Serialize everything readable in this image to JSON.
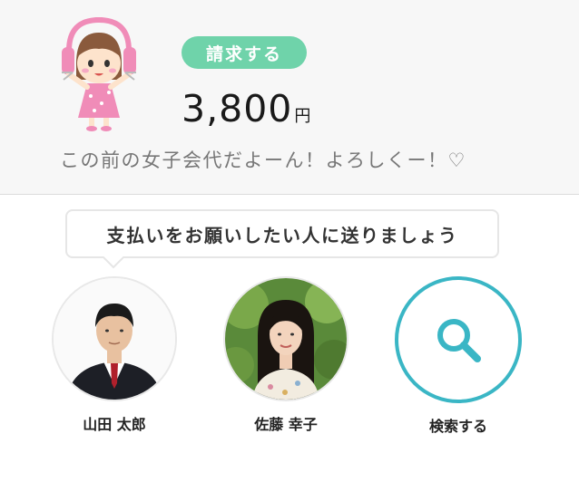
{
  "request": {
    "badge_label": "請求する",
    "amount": "3,800",
    "currency": "円",
    "message": "この前の女子会代だよーん！よろしくー！♡"
  },
  "prompt": {
    "text": "支払いをお願いしたい人に送りましょう"
  },
  "contacts": [
    {
      "name": "山田 太郎",
      "icon": "avatar-man-suit"
    },
    {
      "name": "佐藤 幸子",
      "icon": "avatar-woman-outdoor"
    }
  ],
  "search": {
    "label": "検索する",
    "icon": "search-icon"
  },
  "colors": {
    "badge": "#6fd3aa",
    "search_accent": "#3ab6c5",
    "header_background": "#f7f7f7",
    "message_text": "#777777"
  }
}
